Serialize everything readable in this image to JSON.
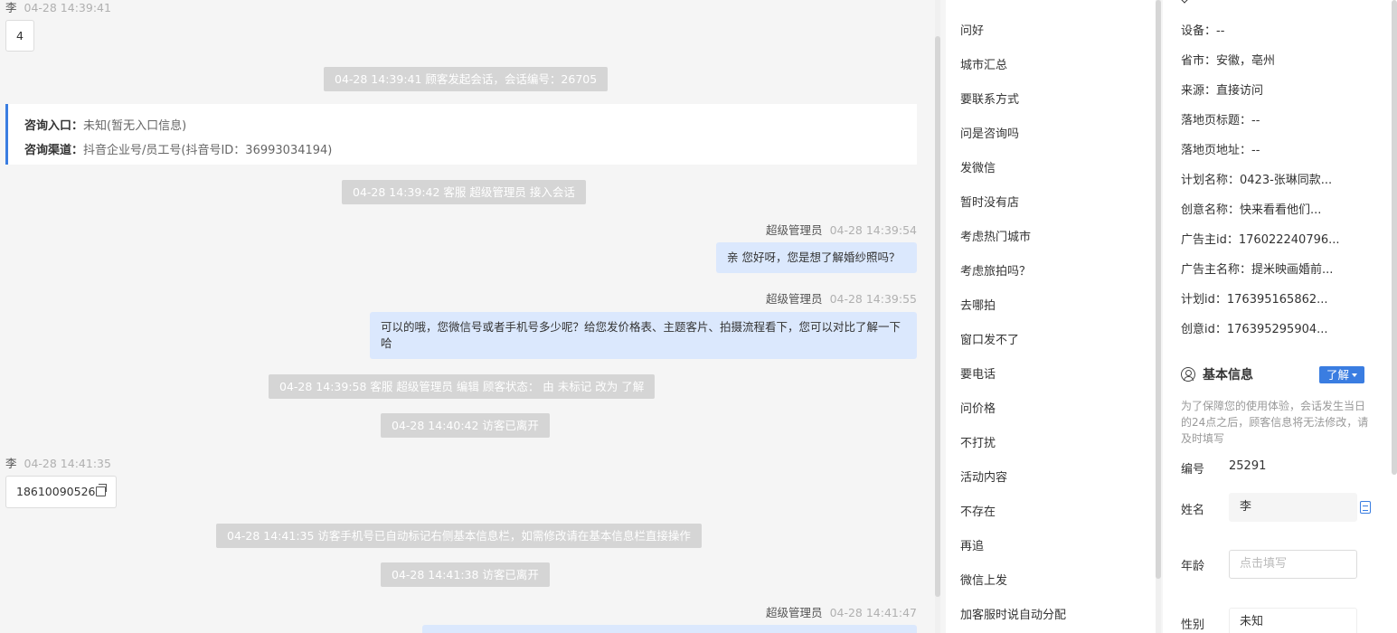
{
  "chat": {
    "messages": {
      "m1": {
        "sender": "李",
        "time": "04-28 14:39:41",
        "text": "4"
      },
      "sys1": "04-28 14:39:41 顾客发起会话，会话编号：26705",
      "entry": {
        "label1": "咨询入口：",
        "value1": "未知(暂无入口信息)",
        "label2": "咨询渠道：",
        "value2": "抖音企业号/员工号(抖音号ID：36993034194)"
      },
      "sys2": "04-28 14:39:42 客服 超级管理员 接入会话",
      "m2": {
        "sender": "超级管理员",
        "time": "04-28 14:39:54",
        "text": "亲 您好呀，您是想了解婚纱照吗？"
      },
      "m3": {
        "sender": "超级管理员",
        "time": "04-28 14:39:55",
        "text": "可以的哦，您微信号或者手机号多少呢？给您发价格表、主题客片、拍摄流程看下，您可以对比了解一下哈"
      },
      "sys3": "04-28 14:39:58 客服 超级管理员 编辑 顾客状态： 由 未标记 改为 了解",
      "sys4": "04-28 14:40:42 访客已离开",
      "m4": {
        "sender": "李",
        "time": "04-28 14:41:35",
        "text": "18610090526"
      },
      "sys5": "04-28 14:41:35 访客手机号已自动标记右侧基本信息栏，如需修改请在基本信息栏直接操作",
      "sys6": "04-28 14:41:38 访客已离开",
      "m5": {
        "sender": "超级管理员",
        "time": "04-28 14:41:47"
      }
    }
  },
  "quick_replies": [
    "问好",
    "城市汇总",
    "要联系方式",
    "问是咨询吗",
    "发微信",
    "暂时没有店",
    "考虑热门城市",
    "考虑旅拍吗？",
    "去哪拍",
    "窗口发不了",
    "要电话",
    "问价格",
    "不打扰",
    "活动内容",
    "不存在",
    "再追",
    "微信上发",
    "加客服时说自动分配"
  ],
  "info": {
    "attrs": [
      {
        "k": "设备：",
        "v": "--"
      },
      {
        "k": "省市：",
        "v": "安徽，亳州"
      },
      {
        "k": "来源：",
        "v": "直接访问"
      },
      {
        "k": "落地页标题：",
        "v": "--"
      },
      {
        "k": "落地页地址：",
        "v": "--"
      },
      {
        "k": "计划名称：",
        "v": "0423-张琳同款..."
      },
      {
        "k": "创意名称：",
        "v": "快来看看他们..."
      },
      {
        "k": "广告主id：",
        "v": "176022240796..."
      },
      {
        "k": "广告主名称：",
        "v": "提米映画婚前..."
      },
      {
        "k": "计划id：",
        "v": "176395165862..."
      },
      {
        "k": "创意id：",
        "v": "176395295904..."
      }
    ],
    "basic_title": "基本信息",
    "status_tag": "了解",
    "notice": "为了保障您的使用体验，会话发生当日的24点之后，顾客信息将无法修改，请及时填写",
    "id_label": "编号",
    "id_value": "25291",
    "name_label": "姓名",
    "name_value": "李",
    "age_label": "年龄",
    "age_placeholder": "点击填写",
    "gender_label": "性别",
    "gender_value": "未知"
  },
  "colors": {
    "accent": "#3a7de1",
    "bubble_right": "#dbe8fd",
    "system_pill": "#d5d5d5"
  }
}
